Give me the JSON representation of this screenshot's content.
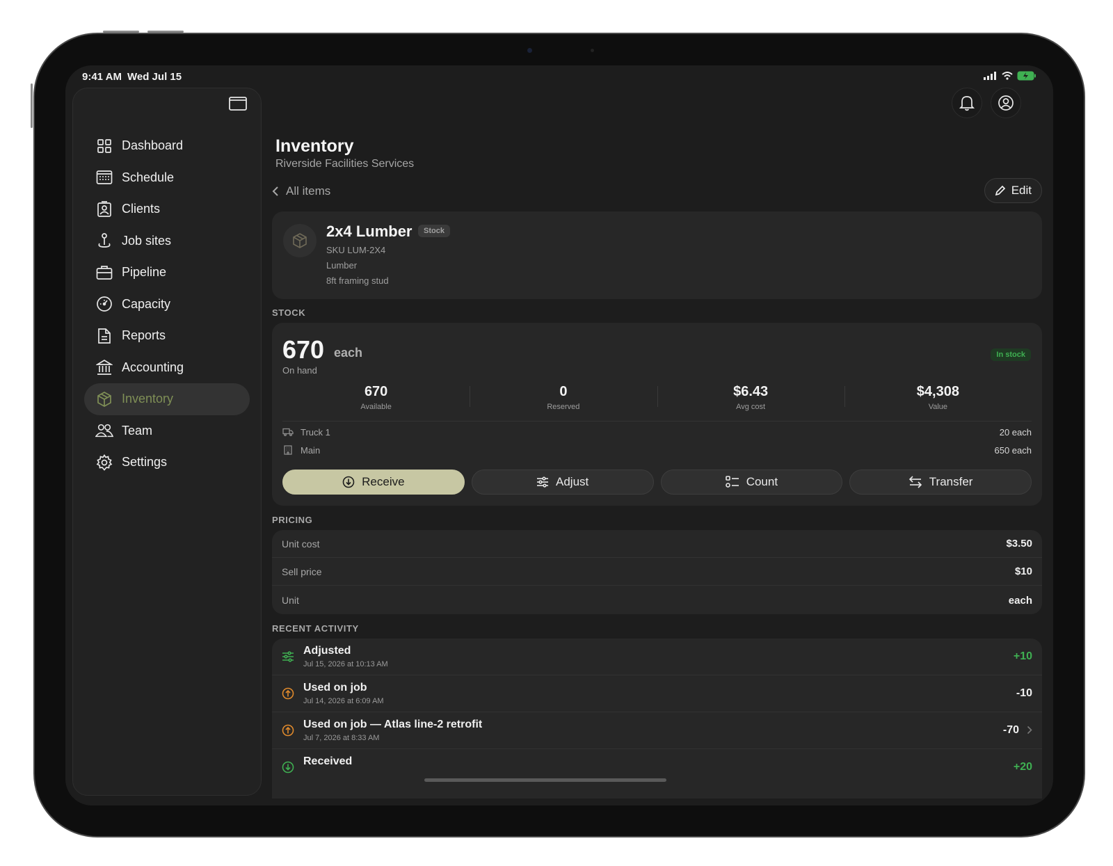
{
  "status": {
    "time": "9:41 AM",
    "date": "Wed Jul 15"
  },
  "sidebar": {
    "items": [
      {
        "label": "Dashboard",
        "icon": "grid-icon"
      },
      {
        "label": "Schedule",
        "icon": "calendar-icon"
      },
      {
        "label": "Clients",
        "icon": "contact-card-icon"
      },
      {
        "label": "Job sites",
        "icon": "map-pin-icon"
      },
      {
        "label": "Pipeline",
        "icon": "briefcase-icon"
      },
      {
        "label": "Capacity",
        "icon": "gauge-icon"
      },
      {
        "label": "Reports",
        "icon": "document-icon"
      },
      {
        "label": "Accounting",
        "icon": "bank-icon"
      },
      {
        "label": "Inventory",
        "icon": "box-icon",
        "active": true
      },
      {
        "label": "Team",
        "icon": "people-icon"
      },
      {
        "label": "Settings",
        "icon": "gear-icon"
      }
    ]
  },
  "header": {
    "title": "Inventory",
    "subtitle": "Riverside Facilities Services",
    "back_label": "All items",
    "edit_label": "Edit"
  },
  "item": {
    "name": "2x4 Lumber",
    "badge": "Stock",
    "sku": "SKU LUM-2X4",
    "category": "Lumber",
    "description": "8ft framing stud"
  },
  "stock": {
    "section_label": "STOCK",
    "on_hand_value": "670",
    "unit": "each",
    "on_hand_label": "On hand",
    "status_badge": "In stock",
    "stats": [
      {
        "value": "670",
        "label": "Available"
      },
      {
        "value": "0",
        "label": "Reserved"
      },
      {
        "value": "$6.43",
        "label": "Avg cost"
      },
      {
        "value": "$4,308",
        "label": "Value"
      }
    ],
    "locations": [
      {
        "name": "Truck 1",
        "qty": "20 each",
        "icon": "truck-icon"
      },
      {
        "name": "Main",
        "qty": "650 each",
        "icon": "building-icon"
      }
    ],
    "actions": [
      {
        "label": "Receive",
        "icon": "download-circle-icon"
      },
      {
        "label": "Adjust",
        "icon": "sliders-icon"
      },
      {
        "label": "Count",
        "icon": "checklist-icon"
      },
      {
        "label": "Transfer",
        "icon": "transfer-arrows-icon"
      }
    ]
  },
  "pricing": {
    "section_label": "PRICING",
    "rows": [
      {
        "label": "Unit cost",
        "value": "$3.50"
      },
      {
        "label": "Sell price",
        "value": "$10"
      },
      {
        "label": "Unit",
        "value": "each"
      }
    ]
  },
  "activity": {
    "section_label": "RECENT ACTIVITY",
    "rows": [
      {
        "title": "Adjusted",
        "date": "Jul 15, 2026 at 10:13 AM",
        "qty": "+10",
        "kind": "adjust"
      },
      {
        "title": "Used on job",
        "date": "Jul 14, 2026 at 6:09 AM",
        "qty": "-10",
        "kind": "used"
      },
      {
        "title": "Used on job — Atlas line-2 retrofit",
        "date": "Jul 7, 2026 at 8:33 AM",
        "qty": "-70",
        "kind": "used",
        "chevron": true
      },
      {
        "title": "Received",
        "date": "",
        "qty": "+20",
        "kind": "received"
      }
    ]
  },
  "colors": {
    "accent": "#c7c7a3",
    "active_nav": "#7f8f56",
    "positive": "#3fb052",
    "used": "#e08a2c"
  }
}
